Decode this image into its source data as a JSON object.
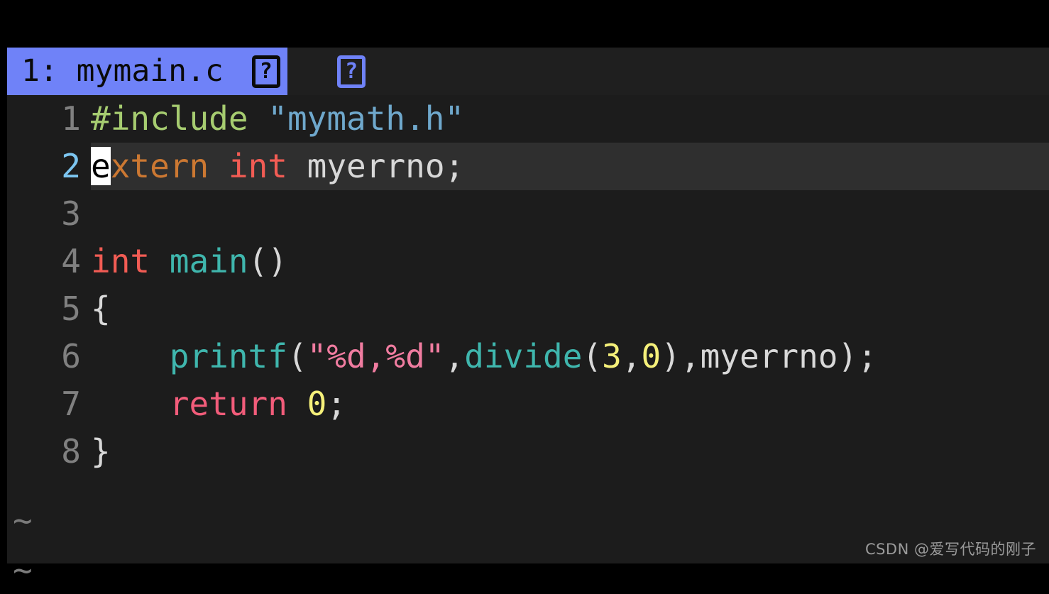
{
  "window": {
    "kind": "terminal-vim-editor",
    "background_color": "#000000",
    "editor_background_color": "#1c1c1c",
    "cursorline_color": "#2f2f2f"
  },
  "tabline": {
    "active_tab": {
      "label": "1: mymain.c ",
      "background_color": "#6f82f8",
      "text_color": "#0a0a0a",
      "trailing_glyph": "?"
    },
    "overflow_glyph": "?"
  },
  "editor": {
    "cursor": {
      "line": 2,
      "column": 1,
      "character": "e",
      "block_color": "#ffffff",
      "block_text_color": "#000000"
    },
    "lines": [
      {
        "number": "1",
        "cursorline": false,
        "tokens": [
          {
            "text": "#include ",
            "cls": "t-preproc"
          },
          {
            "text": "\"mymath.h\"",
            "cls": "t-string"
          }
        ]
      },
      {
        "number": "2",
        "cursorline": true,
        "tokens": [
          {
            "text": "e",
            "cls": "cursor-block"
          },
          {
            "text": "xtern ",
            "cls": "t-type"
          },
          {
            "text": "int",
            "cls": "t-kw-red"
          },
          {
            "text": " myerrno;",
            "cls": "t-plain"
          }
        ]
      },
      {
        "number": "3",
        "cursorline": false,
        "tokens": []
      },
      {
        "number": "4",
        "cursorline": false,
        "tokens": [
          {
            "text": "int ",
            "cls": "t-kw-red"
          },
          {
            "text": "main",
            "cls": "t-func"
          },
          {
            "text": "()",
            "cls": "t-plain"
          }
        ]
      },
      {
        "number": "5",
        "cursorline": false,
        "tokens": [
          {
            "text": "{",
            "cls": "t-plain"
          }
        ]
      },
      {
        "number": "6",
        "cursorline": false,
        "tokens": [
          {
            "text": "    ",
            "cls": "t-plain"
          },
          {
            "text": "printf",
            "cls": "t-func"
          },
          {
            "text": "(",
            "cls": "t-plain"
          },
          {
            "text": "\"%d,%d\"",
            "cls": "t-fmt"
          },
          {
            "text": ",",
            "cls": "t-plain"
          },
          {
            "text": "divide",
            "cls": "t-func"
          },
          {
            "text": "(",
            "cls": "t-plain"
          },
          {
            "text": "3",
            "cls": "t-num"
          },
          {
            "text": ",",
            "cls": "t-plain"
          },
          {
            "text": "0",
            "cls": "t-num"
          },
          {
            "text": "),myerrno);",
            "cls": "t-plain"
          }
        ]
      },
      {
        "number": "7",
        "cursorline": false,
        "tokens": [
          {
            "text": "    ",
            "cls": "t-plain"
          },
          {
            "text": "return ",
            "cls": "t-kw-pink"
          },
          {
            "text": "0",
            "cls": "t-num"
          },
          {
            "text": ";",
            "cls": "t-plain"
          }
        ]
      },
      {
        "number": "8",
        "cursorline": false,
        "tokens": [
          {
            "text": "}",
            "cls": "t-plain"
          }
        ]
      }
    ],
    "empty_line_markers": [
      "~",
      "~"
    ]
  },
  "watermark": {
    "text": "CSDN @爱写代码的刚子"
  }
}
